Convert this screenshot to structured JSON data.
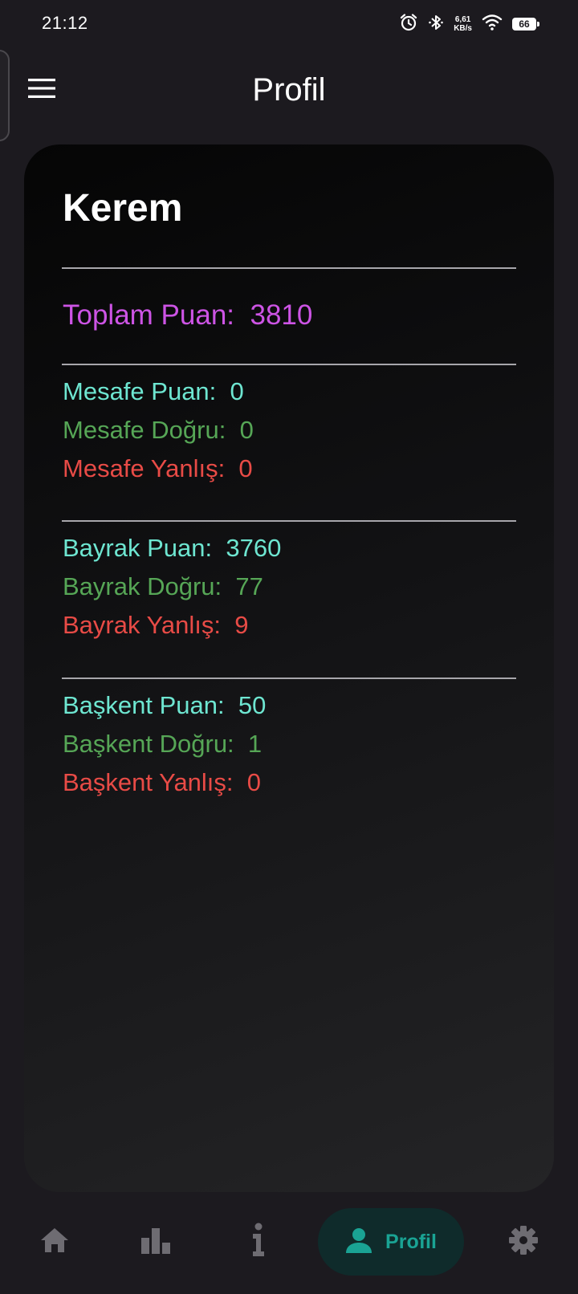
{
  "status_bar": {
    "time": "21:12",
    "net_speed_value": "6,61",
    "net_speed_unit": "KB/s",
    "battery_level": "66",
    "icons": [
      "alarm-icon",
      "bluetooth-icon",
      "wifi-icon",
      "battery-icon"
    ]
  },
  "app_bar": {
    "title": "Profil",
    "menu_icon": "menu-icon"
  },
  "profile": {
    "name": "Kerem",
    "total": {
      "label": "Toplam Puan:",
      "value": "3810"
    },
    "sections": [
      {
        "key": "mesafe",
        "score": {
          "label": "Mesafe Puan:",
          "value": "0"
        },
        "correct": {
          "label": "Mesafe Doğru:",
          "value": "0"
        },
        "wrong": {
          "label": "Mesafe Yanlış:",
          "value": "0"
        }
      },
      {
        "key": "bayrak",
        "score": {
          "label": "Bayrak Puan:",
          "value": "3760"
        },
        "correct": {
          "label": "Bayrak Doğru:",
          "value": "77"
        },
        "wrong": {
          "label": "Bayrak Yanlış:",
          "value": "9"
        }
      },
      {
        "key": "baskent",
        "score": {
          "label": "Başkent Puan:",
          "value": "50"
        },
        "correct": {
          "label": "Başkent Doğru:",
          "value": "1"
        },
        "wrong": {
          "label": "Başkent Yanlış:",
          "value": "0"
        }
      }
    ]
  },
  "bottom_nav": {
    "items": [
      {
        "icon": "home-icon"
      },
      {
        "icon": "leaderboard-icon"
      },
      {
        "icon": "info-icon"
      },
      {
        "icon": "person-icon",
        "label": "Profil",
        "active": true
      },
      {
        "icon": "settings-icon"
      }
    ]
  },
  "colors": {
    "background": "#1c1a1f",
    "total_score": "#cd54e5",
    "score": "#6ee6d1",
    "correct": "#56a656",
    "wrong": "#e84b46",
    "nav_active": "#1aa394",
    "nav_inactive": "#6e6c72"
  }
}
